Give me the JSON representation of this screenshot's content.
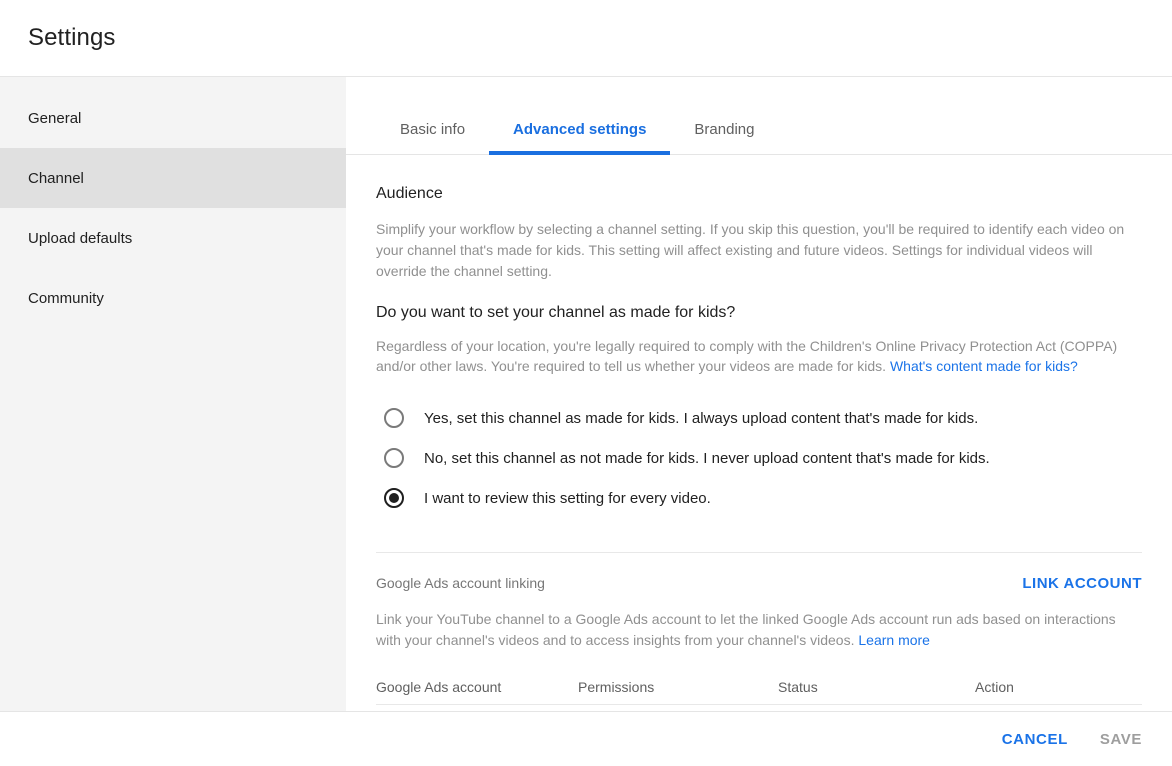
{
  "header": {
    "title": "Settings"
  },
  "sidebar": {
    "items": [
      {
        "label": "General",
        "active": false
      },
      {
        "label": "Channel",
        "active": true
      },
      {
        "label": "Upload defaults",
        "active": false
      },
      {
        "label": "Community",
        "active": false
      }
    ]
  },
  "tabs": [
    {
      "label": "Basic info",
      "active": false
    },
    {
      "label": "Advanced settings",
      "active": true
    },
    {
      "label": "Branding",
      "active": false
    }
  ],
  "audience": {
    "section_title": "Audience",
    "description": "Simplify your workflow by selecting a channel setting. If you skip this question, you'll be required to identify each video on your channel that's made for kids. This setting will affect existing and future videos. Settings for individual videos will override the channel setting.",
    "question": "Do you want to set your channel as made for kids?",
    "legal_text": "Regardless of your location, you're legally required to comply with the Children's Online Privacy Protection Act (COPPA) and/or other laws. You're required to tell us whether your videos are made for kids. ",
    "legal_link": "What's content made for kids?",
    "options": [
      {
        "label": "Yes, set this channel as made for kids. I always upload content that's made for kids.",
        "selected": false
      },
      {
        "label": "No, set this channel as not made for kids. I never upload content that's made for kids.",
        "selected": false
      },
      {
        "label": "I want to review this setting for every video.",
        "selected": true
      }
    ]
  },
  "google_ads": {
    "label": "Google Ads account linking",
    "link_account_button": "LINK ACCOUNT",
    "description": "Link your YouTube channel to a Google Ads account to let the linked Google Ads account run ads based on interactions with your channel's videos and to access insights from your channel's videos. ",
    "learn_more": "Learn more",
    "table_headers": {
      "account": "Google Ads account",
      "permissions": "Permissions",
      "status": "Status",
      "action": "Action"
    }
  },
  "footer": {
    "cancel_label": "CANCEL",
    "save_label": "SAVE"
  },
  "colors": {
    "accent_blue": "#1a73e8",
    "tab_active_blue": "#1a6fe0",
    "sidebar_bg": "#f4f4f4",
    "sidebar_active_bg": "#e0e0e0",
    "muted_text": "#909090"
  }
}
